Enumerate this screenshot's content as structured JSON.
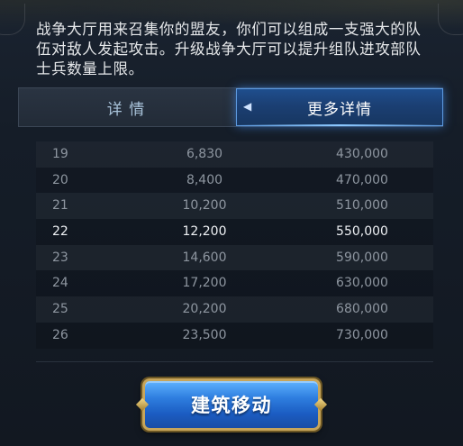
{
  "description": "战争大厅用来召集你的盟友，你们可以组成一支强大的队伍对敌人发起攻击。升级战争大厅可以提升组队进攻部队士兵数量上限。",
  "tabs": {
    "details_label": "详 情",
    "more_label": "更多详情",
    "active": "more"
  },
  "table": {
    "rows": [
      {
        "level": "19",
        "troops": "6,830",
        "capacity": "430,000"
      },
      {
        "level": "20",
        "troops": "8,400",
        "capacity": "470,000"
      },
      {
        "level": "21",
        "troops": "10,200",
        "capacity": "510,000"
      },
      {
        "level": "22",
        "troops": "12,200",
        "capacity": "550,000",
        "current": true
      },
      {
        "level": "23",
        "troops": "14,600",
        "capacity": "590,000"
      },
      {
        "level": "24",
        "troops": "17,200",
        "capacity": "630,000"
      },
      {
        "level": "25",
        "troops": "20,200",
        "capacity": "680,000"
      },
      {
        "level": "26",
        "troops": "23,500",
        "capacity": "730,000"
      }
    ]
  },
  "button": {
    "label": "建筑移动"
  },
  "colors": {
    "accent_blue": "#2f7fe0",
    "gold_border": "#c7a55a",
    "current_row_text": "#eef1f4",
    "row_text": "#8e96a0"
  }
}
